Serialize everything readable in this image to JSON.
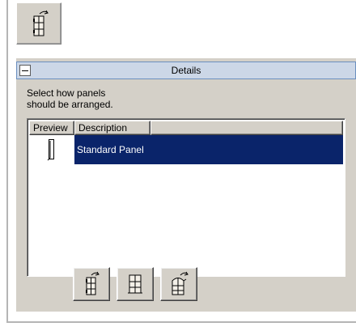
{
  "panel": {
    "title": "Details",
    "collapsed_icon": "minus-icon"
  },
  "instructions": {
    "line1": "Select how panels",
    "line2": "should be arranged."
  },
  "listview": {
    "columns": [
      "Preview",
      "Description"
    ],
    "rows": [
      {
        "preview_icon": "standard-panel-icon",
        "description": "Standard Panel",
        "selected": true
      }
    ]
  },
  "top_button": {
    "icon": "door-panel-hinged-icon"
  },
  "layout_buttons": [
    {
      "icon": "door-panel-hinged-icon"
    },
    {
      "icon": "window-grid-panel-icon"
    },
    {
      "icon": "door-panel-arched-icon"
    }
  ],
  "colors": {
    "selection": "#0a246a",
    "header": "#ccd7e7",
    "face": "#d4d0c8"
  }
}
